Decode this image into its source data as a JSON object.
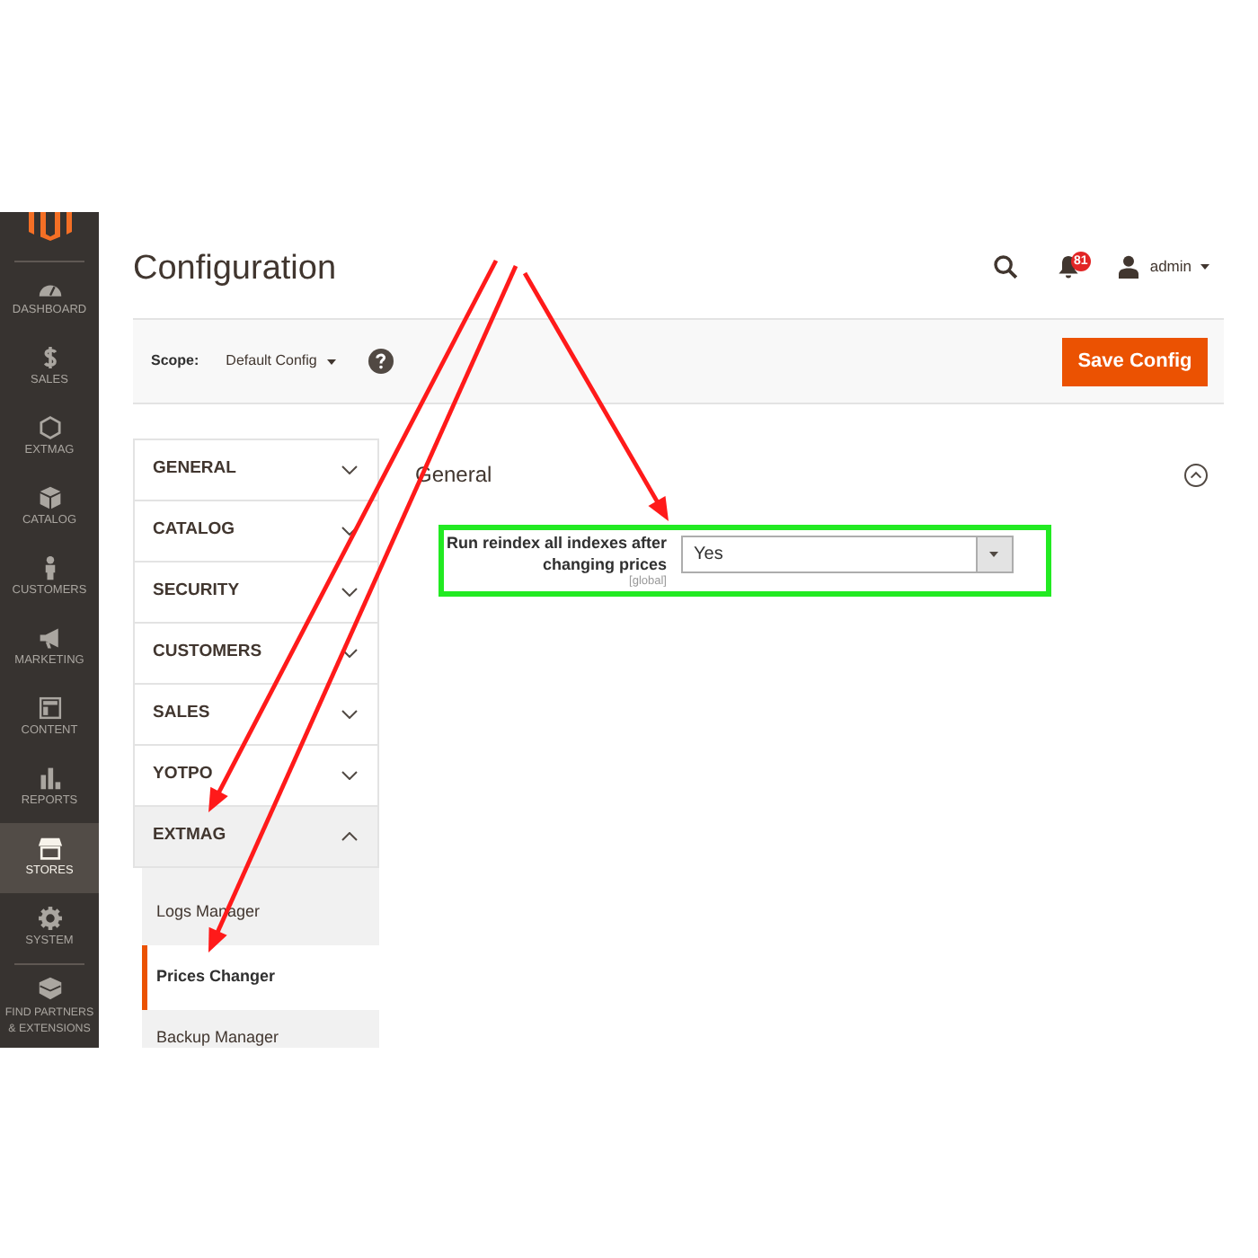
{
  "sidebar": {
    "items": [
      {
        "label": "DASHBOARD",
        "selected": false
      },
      {
        "label": "SALES",
        "selected": false
      },
      {
        "label": "EXTMAG",
        "selected": false
      },
      {
        "label": "CATALOG",
        "selected": false
      },
      {
        "label": "CUSTOMERS",
        "selected": false
      },
      {
        "label": "MARKETING",
        "selected": false
      },
      {
        "label": "CONTENT",
        "selected": false
      },
      {
        "label": "REPORTS",
        "selected": false
      },
      {
        "label": "STORES",
        "selected": true
      },
      {
        "label": "SYSTEM",
        "selected": false
      },
      {
        "label": "FIND PARTNERS & EXTENSIONS",
        "selected": false
      }
    ]
  },
  "header": {
    "title": "Configuration",
    "notification_count": "81",
    "user": "admin"
  },
  "scope_bar": {
    "label": "Scope:",
    "value": "Default Config",
    "save_button": "Save Config"
  },
  "nav": {
    "sections": [
      {
        "label": "GENERAL",
        "expanded": false,
        "arrow": false
      },
      {
        "label": "CATALOG",
        "expanded": false,
        "arrow": false
      },
      {
        "label": "SECURITY",
        "expanded": false,
        "arrow": false
      },
      {
        "label": "CUSTOMERS",
        "expanded": false,
        "arrow": false
      },
      {
        "label": "SALES",
        "expanded": false,
        "arrow": false
      },
      {
        "label": "YOTPO",
        "expanded": false,
        "arrow": false
      },
      {
        "label": "EXTMAG",
        "expanded": true,
        "arrow": true,
        "children": [
          {
            "label": "Logs Manager",
            "selected": false,
            "arrow": false
          },
          {
            "label": "Prices Changer",
            "selected": true,
            "arrow": true
          },
          {
            "label": "Backup Manager",
            "selected": false,
            "arrow": false
          }
        ]
      }
    ]
  },
  "content": {
    "section_title": "General",
    "expanded": true,
    "fields": [
      {
        "label": "Run reindex all indexes after changing prices",
        "scope": "[global]",
        "value": "Yes",
        "highlighted": true,
        "arrow": true
      }
    ]
  }
}
